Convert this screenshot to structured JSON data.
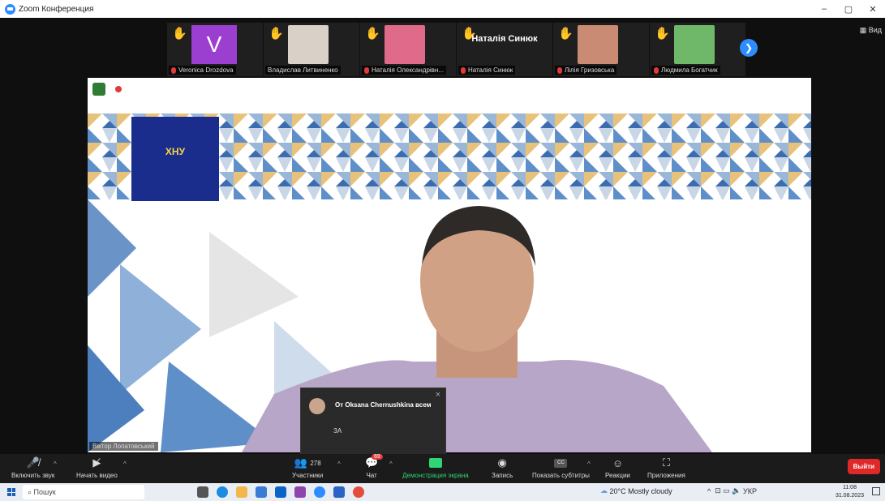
{
  "window": {
    "title": "Zoom Конференция"
  },
  "gallery": {
    "participants": [
      {
        "display": "V",
        "label": "Veronica Drozdova",
        "kind": "avatar",
        "color": "#9b3fd1"
      },
      {
        "display": "",
        "label": "Владислав Литвиненко",
        "kind": "photo",
        "color": "#d9d0c8"
      },
      {
        "display": "",
        "label": "Наталія Олександрівн...",
        "kind": "photo",
        "color": "#e06a8a"
      },
      {
        "display": "Наталія Синюк",
        "label": "Наталія Синюк",
        "kind": "name"
      },
      {
        "display": "",
        "label": "Лілія Гризовська",
        "kind": "photo",
        "color": "#c98b73"
      },
      {
        "display": "",
        "label": "Людмила Богатчик",
        "kind": "photo",
        "color": "#6fb86a"
      }
    ],
    "view_label": "Вид"
  },
  "main_video": {
    "speaker_label": "Віктор Лопатовський",
    "logo_text": "ХНУ"
  },
  "chat_popup": {
    "from": "От Oksana Chernushkina всем",
    "message": "ЗА"
  },
  "toolbar": {
    "audio": "Включить звук",
    "video": "Начать видео",
    "participants": "Участники",
    "participants_count": "278",
    "chat": "Чат",
    "chat_badge": "69",
    "share": "Демонстрация экрана",
    "record": "Запись",
    "captions": "Показать субтитры",
    "reactions": "Реакции",
    "apps": "Приложения",
    "leave": "Выйти"
  },
  "taskbar": {
    "search": "Пошук",
    "weather": "20°C  Mostly cloudy",
    "lang": "УКР",
    "time": "11:08",
    "date": "31.08.2023"
  },
  "colors": {
    "accent": "#2d8cff",
    "share_green": "#2ed573",
    "leave_red": "#e02828"
  }
}
